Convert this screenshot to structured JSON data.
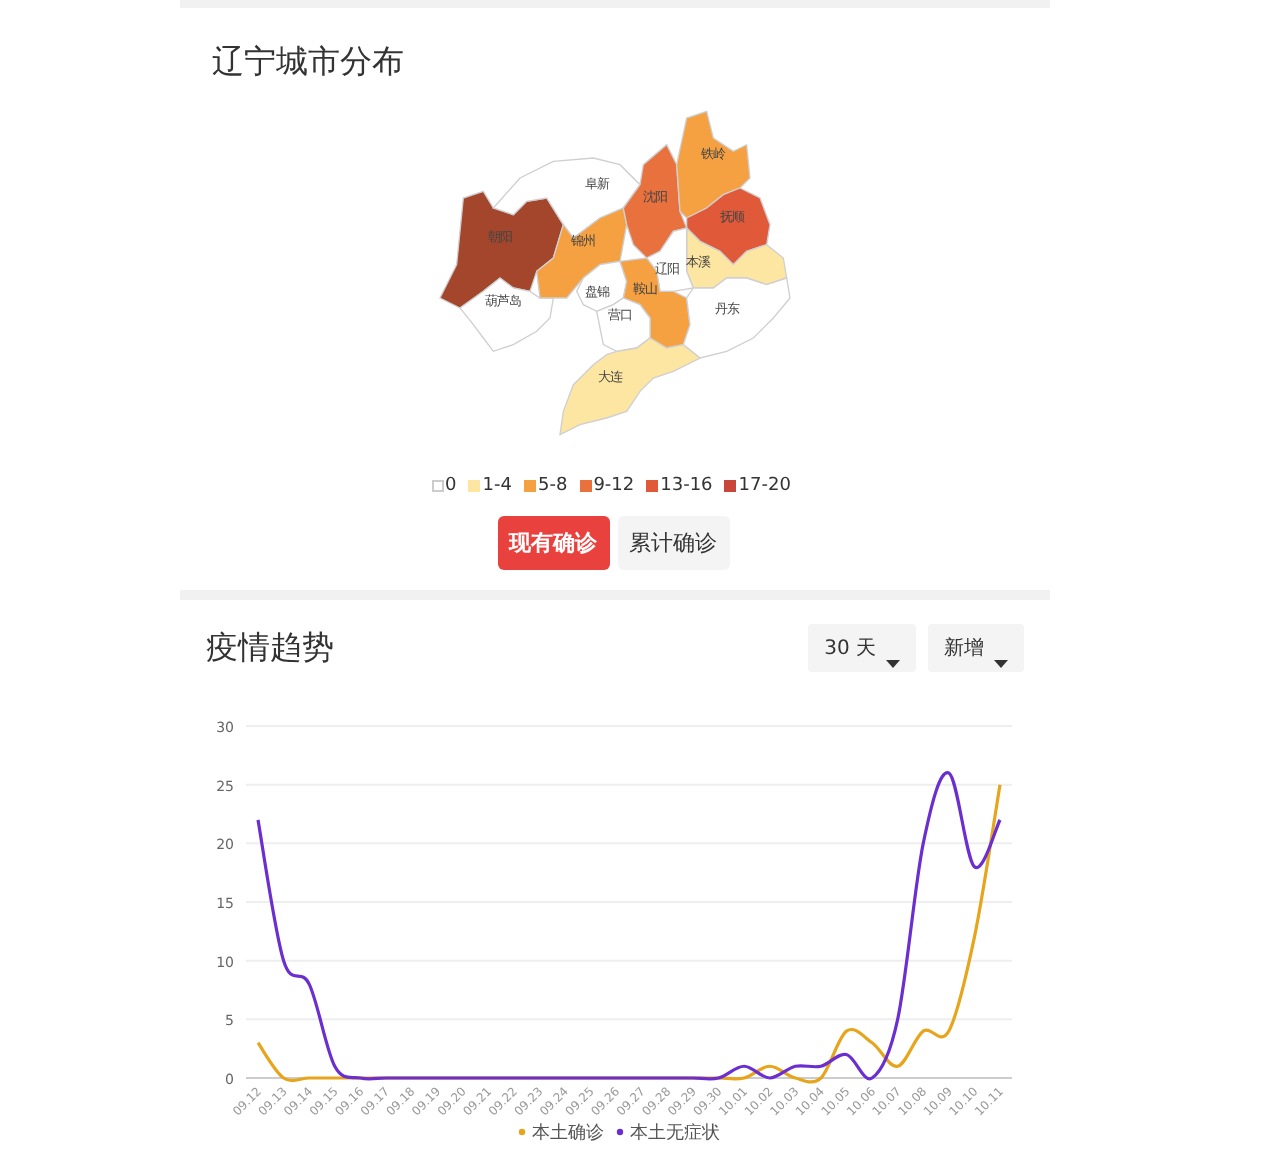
{
  "map_section": {
    "title": "辽宁城市分布",
    "regions": [
      {
        "name": "朝阳",
        "color": "#a3462c"
      },
      {
        "name": "阜新",
        "color": "#ffffff"
      },
      {
        "name": "葫芦岛",
        "color": "#ffffff"
      },
      {
        "name": "锦州",
        "color": "#f5a142"
      },
      {
        "name": "盘锦",
        "color": "#ffffff"
      },
      {
        "name": "沈阳",
        "color": "#e8713e"
      },
      {
        "name": "铁岭",
        "color": "#f5a142"
      },
      {
        "name": "抚顺",
        "color": "#e05a3a"
      },
      {
        "name": "本溪",
        "color": "#fde5a2"
      },
      {
        "name": "辽阳",
        "color": "#ffffff"
      },
      {
        "name": "鞍山",
        "color": "#f5a142"
      },
      {
        "name": "营口",
        "color": "#ffffff"
      },
      {
        "name": "丹东",
        "color": "#ffffff"
      },
      {
        "name": "大连",
        "color": "#fde5a2"
      }
    ],
    "legend": [
      {
        "label": "0",
        "color": "#ffffff"
      },
      {
        "label": "1-4",
        "color": "#fde5a2"
      },
      {
        "label": "5-8",
        "color": "#f5a142"
      },
      {
        "label": "9-12",
        "color": "#e8713e"
      },
      {
        "label": "13-16",
        "color": "#e05a3a"
      },
      {
        "label": "17-20",
        "color": "#c8463a"
      }
    ],
    "buttons": [
      {
        "label": "现有确诊",
        "selected": true
      },
      {
        "label": "累计确诊",
        "selected": false
      }
    ]
  },
  "trend_section": {
    "title": "疫情趋势",
    "dropdowns": [
      {
        "label": "30 天"
      },
      {
        "label": "新增"
      }
    ],
    "chart_data": {
      "type": "line",
      "grid": true,
      "legend": "bottom",
      "ylim": [
        0,
        30
      ],
      "yticks": [
        0,
        5,
        10,
        15,
        20,
        25,
        30
      ],
      "categories": [
        "09.12",
        "09.13",
        "09.14",
        "09.15",
        "09.16",
        "09.17",
        "09.18",
        "09.19",
        "09.20",
        "09.21",
        "09.22",
        "09.23",
        "09.24",
        "09.25",
        "09.26",
        "09.27",
        "09.28",
        "09.29",
        "09.30",
        "10.01",
        "10.02",
        "10.03",
        "10.04",
        "10.05",
        "10.06",
        "10.07",
        "10.08",
        "10.09",
        "10.10",
        "10.11"
      ],
      "series": [
        {
          "name": "本土确诊",
          "color": "#e6a51c",
          "values": [
            3,
            0,
            0,
            0,
            0,
            0,
            0,
            0,
            0,
            0,
            0,
            0,
            0,
            0,
            0,
            0,
            0,
            0,
            0,
            0,
            1,
            0,
            0,
            4,
            3,
            1,
            4,
            4,
            12,
            25
          ]
        },
        {
          "name": "本土无症状",
          "color": "#6b2fd0",
          "values": [
            22,
            10,
            8,
            1,
            0,
            0,
            0,
            0,
            0,
            0,
            0,
            0,
            0,
            0,
            0,
            0,
            0,
            0,
            0,
            1,
            0,
            1,
            1,
            2,
            0,
            5,
            20,
            26,
            18,
            22
          ]
        }
      ]
    }
  }
}
